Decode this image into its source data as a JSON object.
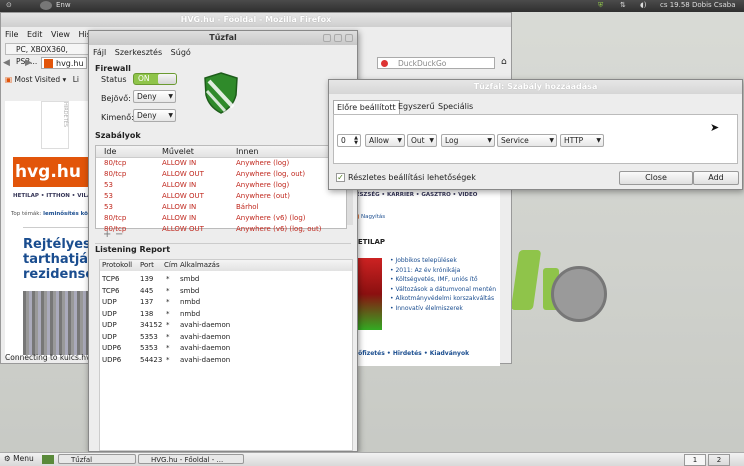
{
  "top_panel": {
    "left_icon": "cd-icon",
    "left_text": "Enw",
    "time": "cs 19.58",
    "user": "Dobis Csaba"
  },
  "firefox": {
    "title": "HVG.hu - Főoldal - Mozilla Firefox",
    "menu": [
      "File",
      "Edit",
      "View",
      "Histo"
    ],
    "bookmark_bar_tab": "PC, XBOX360, PS3...",
    "url": "hvg.hu",
    "search_placeholder": "DuckDuckGo",
    "most_visited": "Most Visited",
    "li_label": "Li",
    "status": "Connecting to kulcs.hvg",
    "page": {
      "logo": "hvg.hu",
      "nav": "HETILAP • ITTHON • VILÁG",
      "topics": "Top témák:",
      "topic1": "leminősítés",
      "topic2": "kö",
      "headline": [
        "Rejtélyes te",
        "tarthatják it",
        "rezidensek"
      ],
      "right_nav": "• EGÉSZSÉG • KARRIER • GASZTRO • VIDEO",
      "right_link": "Nagyítás",
      "hetilap": "HETILAP",
      "links": [
        "Jobbikos települések",
        "2011: Az év krónikája",
        "Költségvetés, IMF, uniós ítő",
        "Változások a dátumvonal mentén",
        "Alkotmányvédelmi korszakváltás",
        "Innovatív élelmiszerek"
      ],
      "bottom_links": [
        "Előfizetés",
        "Hirdetés",
        "Kiadványok"
      ]
    }
  },
  "tuzfal": {
    "title": "Tűzfal",
    "menu": [
      "Fájl",
      "Szerkesztés",
      "Súgó"
    ],
    "firewall_heading": "Firewall",
    "status_label": "Status",
    "status_value": "ON",
    "incoming_label": "Bejövő:",
    "incoming_value": "Deny",
    "outgoing_label": "Kimenő:",
    "outgoing_value": "Deny",
    "rules_heading": "Szabályok",
    "rules_columns": [
      "Ide",
      "Művelet",
      "Innen"
    ],
    "rules": [
      [
        "80/tcp",
        "ALLOW IN",
        "Anywhere (log)"
      ],
      [
        "80/tcp",
        "ALLOW OUT",
        "Anywhere (log, out)"
      ],
      [
        "53",
        "ALLOW IN",
        "Anywhere (log)"
      ],
      [
        "53",
        "ALLOW OUT",
        "Anywhere (out)"
      ],
      [
        "53",
        "ALLOW IN",
        "Bárhol"
      ],
      [
        "80/tcp",
        "ALLOW IN",
        "Anywhere (v6) (log)"
      ],
      [
        "80/tcp",
        "ALLOW OUT",
        "Anywhere (v6) (log, out)"
      ]
    ],
    "add_label": "+",
    "remove_label": "−",
    "listening_heading": "Listening Report",
    "listening_columns": [
      "Protokoll",
      "Port",
      "Cím",
      "Alkalmazás"
    ],
    "listening": [
      [
        "TCP6",
        "139",
        "*",
        "smbd"
      ],
      [
        "TCP6",
        "445",
        "*",
        "smbd"
      ],
      [
        "UDP",
        "137",
        "*",
        "nmbd"
      ],
      [
        "UDP",
        "138",
        "*",
        "nmbd"
      ],
      [
        "UDP",
        "34152",
        "*",
        "avahi-daemon"
      ],
      [
        "UDP",
        "5353",
        "*",
        "avahi-daemon"
      ],
      [
        "UDP6",
        "5353",
        "*",
        "avahi-daemon"
      ],
      [
        "UDP6",
        "54423",
        "*",
        "avahi-daemon"
      ]
    ]
  },
  "rule_dialog": {
    "title": "Tűzfal: Szabály hozzáadása",
    "tabs": [
      "Előre beállított",
      "Egyszerű",
      "Speciális"
    ],
    "number": "0",
    "action": "Allow",
    "direction": "Out",
    "log": "Log",
    "type": "Service",
    "service": "HTTP",
    "details_label": "Részletes beállítási lehetőségek",
    "close_label": "Close",
    "add_label": "Add"
  },
  "bottom_panel": {
    "menu": "Menu",
    "tasks": [
      "Tűzfal",
      "HVG.hu - Főoldal - ..."
    ],
    "workspaces": [
      "1",
      "2"
    ]
  },
  "colors": {
    "accent_green": "#8fc44a",
    "rule_red": "#c0281e",
    "hvg_orange": "#e2550a"
  }
}
